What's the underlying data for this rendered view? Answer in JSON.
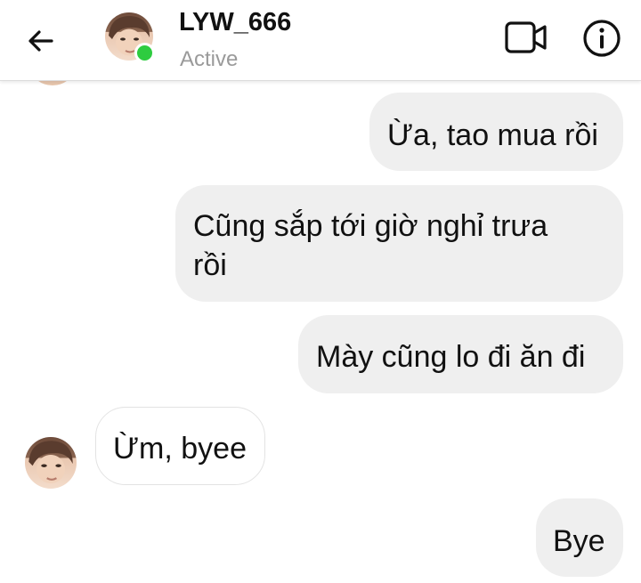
{
  "header": {
    "username": "LYW_666",
    "status": "Active",
    "icons": {
      "back": "back-arrow-icon",
      "video": "video-call-icon",
      "info": "info-icon"
    }
  },
  "messages": [
    {
      "sender": "me",
      "text": "Ừa, tao mua rồi"
    },
    {
      "sender": "me",
      "text": "Cũng sắp tới giờ nghỉ trưa rồi"
    },
    {
      "sender": "me",
      "text": "Mày cũng lo đi ăn đi"
    },
    {
      "sender": "them",
      "text": "Ừm, byee"
    },
    {
      "sender": "me",
      "text": "Bye"
    }
  ],
  "colors": {
    "online": "#2ecc40",
    "outgoing_bubble": "#efefef",
    "status_text": "#9a9a9a"
  }
}
